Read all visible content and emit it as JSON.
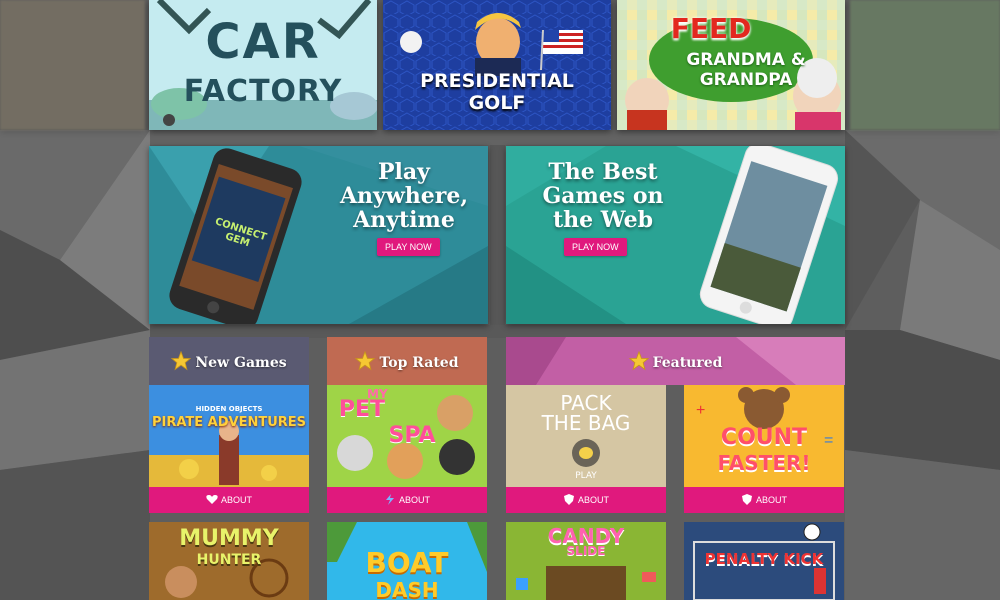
{
  "top_games": [
    {
      "title_line1": "CAR",
      "title_line2": "FACTORY"
    },
    {
      "title_line1": "PRESIDENTIAL",
      "title_line2": "GOLF"
    },
    {
      "title_line1": "FEED",
      "title_line2": "GRANDMA &",
      "title_line3": "GRANDPA"
    }
  ],
  "banners": [
    {
      "heading_lines": [
        "Play",
        "Anywhere,",
        "Anytime"
      ],
      "button": "PLAY NOW",
      "phone_text": "CONNECT GEM"
    },
    {
      "heading_lines": [
        "The Best",
        "Games on",
        "the Web"
      ],
      "button": "PLAY NOW"
    }
  ],
  "sections": {
    "new_games": "New Games",
    "top_rated": "Top Rated",
    "featured": "Featured"
  },
  "cards": [
    {
      "title": "PIRATE ADVENTURES",
      "subtitle": "HIDDEN OBJECTS",
      "about": "ABOUT",
      "about_icon": "heart-icon"
    },
    {
      "title_line1": "MY",
      "title_line2": "PET",
      "title_line3": "SPA",
      "about": "ABOUT",
      "about_icon": "lightning-icon"
    },
    {
      "title_line1": "PACK",
      "title_line2": "THE BAG",
      "play": "PLAY",
      "about": "ABOUT",
      "about_icon": "shield-icon"
    },
    {
      "title_line1": "COUNT",
      "title_line2": "FASTER!",
      "about": "ABOUT",
      "about_icon": "shield-icon"
    },
    {
      "title_line1": "MUMMY",
      "title_line2": "HUNTER"
    },
    {
      "title_line1": "BOAT",
      "title_line2": "DASH"
    },
    {
      "title_line1": "CANDY",
      "title_line2": "SLIDE"
    },
    {
      "title": "PENALTY KICK"
    }
  ],
  "colors": {
    "accent": "#e0197d",
    "teal": "#2a9a9a",
    "background": "#5b5b5b"
  }
}
